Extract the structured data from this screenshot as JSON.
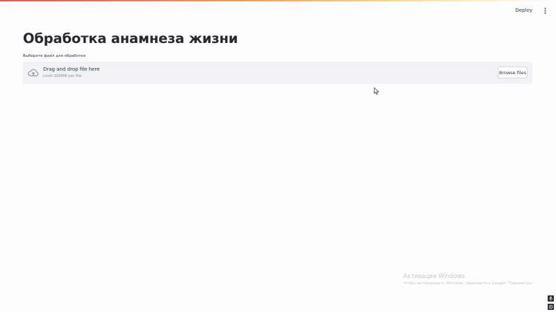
{
  "header": {
    "deploy_label": "Deploy",
    "menu_icon": "vertical-ellipsis-icon"
  },
  "main": {
    "title": "Обработка анамнеза жизни",
    "uploader": {
      "label": "Выберите файл для обработки",
      "dropzone_title": "Drag and drop file here",
      "limit_text": "Limit 200MB per file",
      "browse_label": "Browse files",
      "icon": "cloud-upload-icon"
    }
  },
  "watermark": {
    "title": "Активация Windows",
    "subtitle": "Чтобы активировать Windows, перейдите в раздел \"Параметры\"."
  },
  "colors": {
    "accent_gradient_start": "#ff4b4b",
    "dropzone_bg": "#f0f2f6",
    "text": "#31333f"
  }
}
